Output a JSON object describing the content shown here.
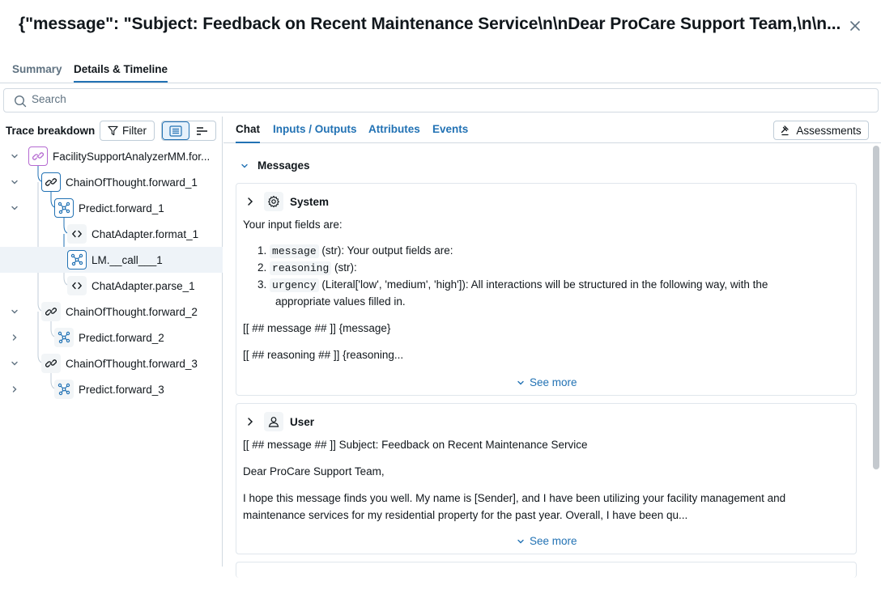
{
  "header": {
    "title": "{\"message\": \"Subject: Feedback on Recent Maintenance Service\\n\\nDear ProCare Support Team,\\n\\n..."
  },
  "tabs": [
    "Summary",
    "Details & Timeline"
  ],
  "search": {
    "placeholder": "Search"
  },
  "trace": {
    "title": "Trace breakdown",
    "filter_label": "Filter",
    "nodes": [
      {
        "label": "FacilitySupportAnalyzerMM.for...",
        "icon": "link-icon"
      },
      {
        "label": "ChainOfThought.forward_1",
        "icon": "link-icon"
      },
      {
        "label": "Predict.forward_1",
        "icon": "model-icon"
      },
      {
        "label": "ChatAdapter.format_1",
        "icon": "code-icon"
      },
      {
        "label": "LM.__call___1",
        "icon": "model-icon"
      },
      {
        "label": "ChatAdapter.parse_1",
        "icon": "code-icon"
      },
      {
        "label": "ChainOfThought.forward_2",
        "icon": "link-icon"
      },
      {
        "label": "Predict.forward_2",
        "icon": "model-icon"
      },
      {
        "label": "ChainOfThought.forward_3",
        "icon": "link-icon"
      },
      {
        "label": "Predict.forward_3",
        "icon": "model-icon"
      }
    ]
  },
  "detail_tabs": [
    "Chat",
    "Inputs / Outputs",
    "Attributes",
    "Events"
  ],
  "assessments_label": "Assessments",
  "messages": {
    "header": "Messages",
    "system": {
      "role": "System",
      "intro": "Your input fields are:",
      "items": [
        {
          "num": "1.",
          "code": "message",
          "text": " (str): Your output fields are:"
        },
        {
          "num": "2.",
          "code": "reasoning",
          "text": " (str):"
        },
        {
          "num": "3.",
          "code": "urgency",
          "text": " (Literal['low', 'medium', 'high']): All interactions will be structured in the following way, with the"
        }
      ],
      "item3_cont": "appropriate values filled in.",
      "line_message": "[[ ## message ## ]] {message}",
      "line_reasoning": "[[ ## reasoning ## ]] {reasoning...",
      "see_more": "See more"
    },
    "user": {
      "role": "User",
      "line1": "[[ ## message ## ]] Subject: Feedback on Recent Maintenance Service",
      "line2": "Dear ProCare Support Team,",
      "line3": "I hope this message finds you well. My name is [Sender], and I have been utilizing your facility management and",
      "line4": "maintenance services for my residential property for the past year. Overall, I have been qu...",
      "see_more": "See more"
    }
  },
  "colors": {
    "accent": "#2272b4",
    "border": "#d1d9e1",
    "text": "#11171c",
    "muted": "#5f7281"
  }
}
